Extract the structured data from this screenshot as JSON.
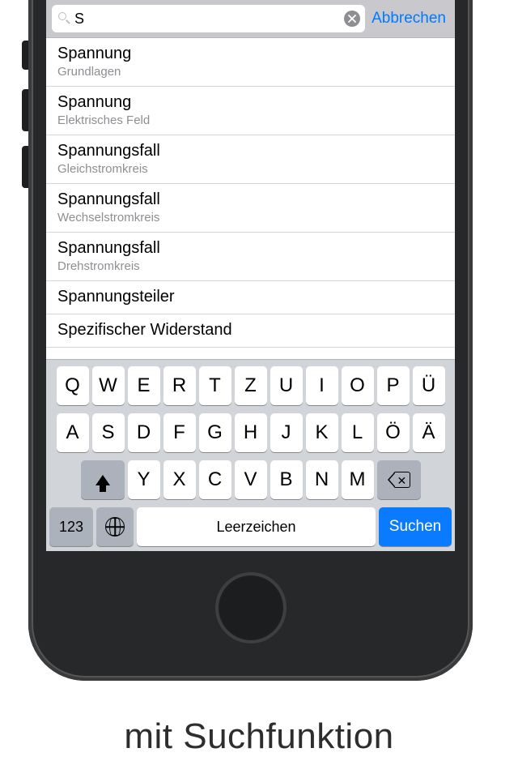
{
  "search": {
    "value": "S",
    "cancel_label": "Abbrechen"
  },
  "results": [
    {
      "title": "Spannung",
      "subtitle": "Grundlagen"
    },
    {
      "title": "Spannung",
      "subtitle": "Elektrisches Feld"
    },
    {
      "title": "Spannungsfall",
      "subtitle": "Gleichstromkreis"
    },
    {
      "title": "Spannungsfall",
      "subtitle": "Wechselstromkreis"
    },
    {
      "title": "Spannungsfall",
      "subtitle": "Drehstromkreis"
    },
    {
      "title": "Spannungsteiler",
      "subtitle": ""
    },
    {
      "title": "Spezifischer Widerstand",
      "subtitle": ""
    }
  ],
  "keyboard": {
    "rows": [
      [
        "Q",
        "W",
        "E",
        "R",
        "T",
        "Z",
        "U",
        "I",
        "O",
        "P",
        "Ü"
      ],
      [
        "A",
        "S",
        "D",
        "F",
        "G",
        "H",
        "J",
        "K",
        "L",
        "Ö",
        "Ä"
      ],
      [
        "Y",
        "X",
        "C",
        "V",
        "B",
        "N",
        "M"
      ]
    ],
    "num_label": "123",
    "space_label": "Leerzeichen",
    "search_label": "Suchen"
  },
  "caption": "mit Suchfunktion"
}
